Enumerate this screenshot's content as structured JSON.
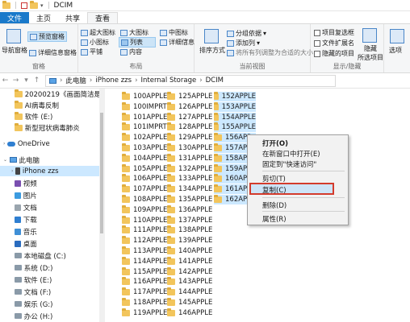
{
  "window": {
    "title": "DCIM"
  },
  "tabs": [
    "文件",
    "主页",
    "共享",
    "查看"
  ],
  "ribbon": {
    "pane": {
      "nav": "导航窗格",
      "preview": "预览窗格",
      "details": "详细信息窗格",
      "group": "窗格"
    },
    "layout": {
      "items": [
        "超大图标",
        "大图标",
        "中图标",
        "小图标",
        "列表",
        "详细信息",
        "平铺",
        "内容"
      ],
      "selected": "列表",
      "group": "布局"
    },
    "view": {
      "sort": "排序方式",
      "group_by": "分组依据",
      "add_col": "添加列",
      "fit_cols": "将所有列调整为合适的大小",
      "group": "当前视图"
    },
    "showhide": {
      "checkbox": "项目复选框",
      "ext": "文件扩展名",
      "hidden": "隐藏的项目",
      "hide_sel": "隐藏",
      "hide_sel2": "所选项目",
      "group": "显示/隐藏"
    },
    "options": "选项"
  },
  "address": {
    "path": [
      "此电脑",
      "iPhone zzs",
      "Internal Storage",
      "DCIM"
    ]
  },
  "sidebar": {
    "items": [
      {
        "label": "20200219《画面简洁是拍好拜",
        "type": "folder"
      },
      {
        "label": "AI病毒反制",
        "type": "folder"
      },
      {
        "label": "软件 (E:)",
        "type": "folder"
      },
      {
        "label": "新型冠状病毒肺炎",
        "type": "folder"
      },
      {
        "label": "OneDrive",
        "type": "cloud"
      },
      {
        "label": "此电脑",
        "type": "pc"
      },
      {
        "label": "iPhone zzs",
        "type": "phone"
      },
      {
        "label": "视频",
        "type": "lib"
      },
      {
        "label": "图片",
        "type": "lib"
      },
      {
        "label": "文档",
        "type": "lib"
      },
      {
        "label": "下载",
        "type": "lib"
      },
      {
        "label": "音乐",
        "type": "lib"
      },
      {
        "label": "桌面",
        "type": "lib"
      },
      {
        "label": "本地磁盘 (C:)",
        "type": "drive"
      },
      {
        "label": "系统 (D:)",
        "type": "drive"
      },
      {
        "label": "软件 (E:)",
        "type": "drive"
      },
      {
        "label": "文档 (F:)",
        "type": "drive"
      },
      {
        "label": "娱乐 (G:)",
        "type": "drive"
      },
      {
        "label": "办公 (H:)",
        "type": "drive"
      }
    ],
    "selected": "iPhone zzs"
  },
  "files": {
    "col1": [
      "100APPLE",
      "100IMPRT",
      "101APPLE",
      "101IMPRT",
      "102APPLE",
      "103APPLE",
      "104APPLE",
      "105APPLE",
      "106APPLE",
      "107APPLE",
      "108APPLE",
      "109APPLE",
      "110APPLE",
      "111APPLE",
      "112APPLE",
      "113APPLE",
      "114APPLE",
      "115APPLE",
      "116APPLE",
      "117APPLE",
      "118APPLE",
      "119APPLE"
    ],
    "col2": [
      "125APPLE",
      "126APPLE",
      "127APPLE",
      "128APPLE",
      "129APPLE",
      "130APPLE",
      "131APPLE",
      "132APPLE",
      "133APPLE",
      "134APPLE",
      "135APPLE",
      "136APPLE",
      "137APPLE",
      "138APPLE",
      "139APPLE",
      "140APPLE",
      "141APPLE",
      "142APPLE",
      "143APPLE",
      "144APPLE",
      "145APPLE",
      "146APPLE"
    ],
    "col3": [
      "152APPLE",
      "153APPLE",
      "154APPLE",
      "155APPLE",
      "156APP",
      "157APP",
      "158APP",
      "159APP",
      "160APP",
      "161APP",
      "162APP"
    ]
  },
  "context_menu": {
    "items": [
      "打开(O)",
      "在新窗口中打开(E)",
      "固定到\"快速访问\"",
      "剪切(T)",
      "复制(C)",
      "删除(D)",
      "属性(R)"
    ]
  },
  "colors": {
    "accent": "#1979ca",
    "highlight": "#d33b2c",
    "selection": "#cce8ff",
    "folder": "#f2c55c"
  }
}
